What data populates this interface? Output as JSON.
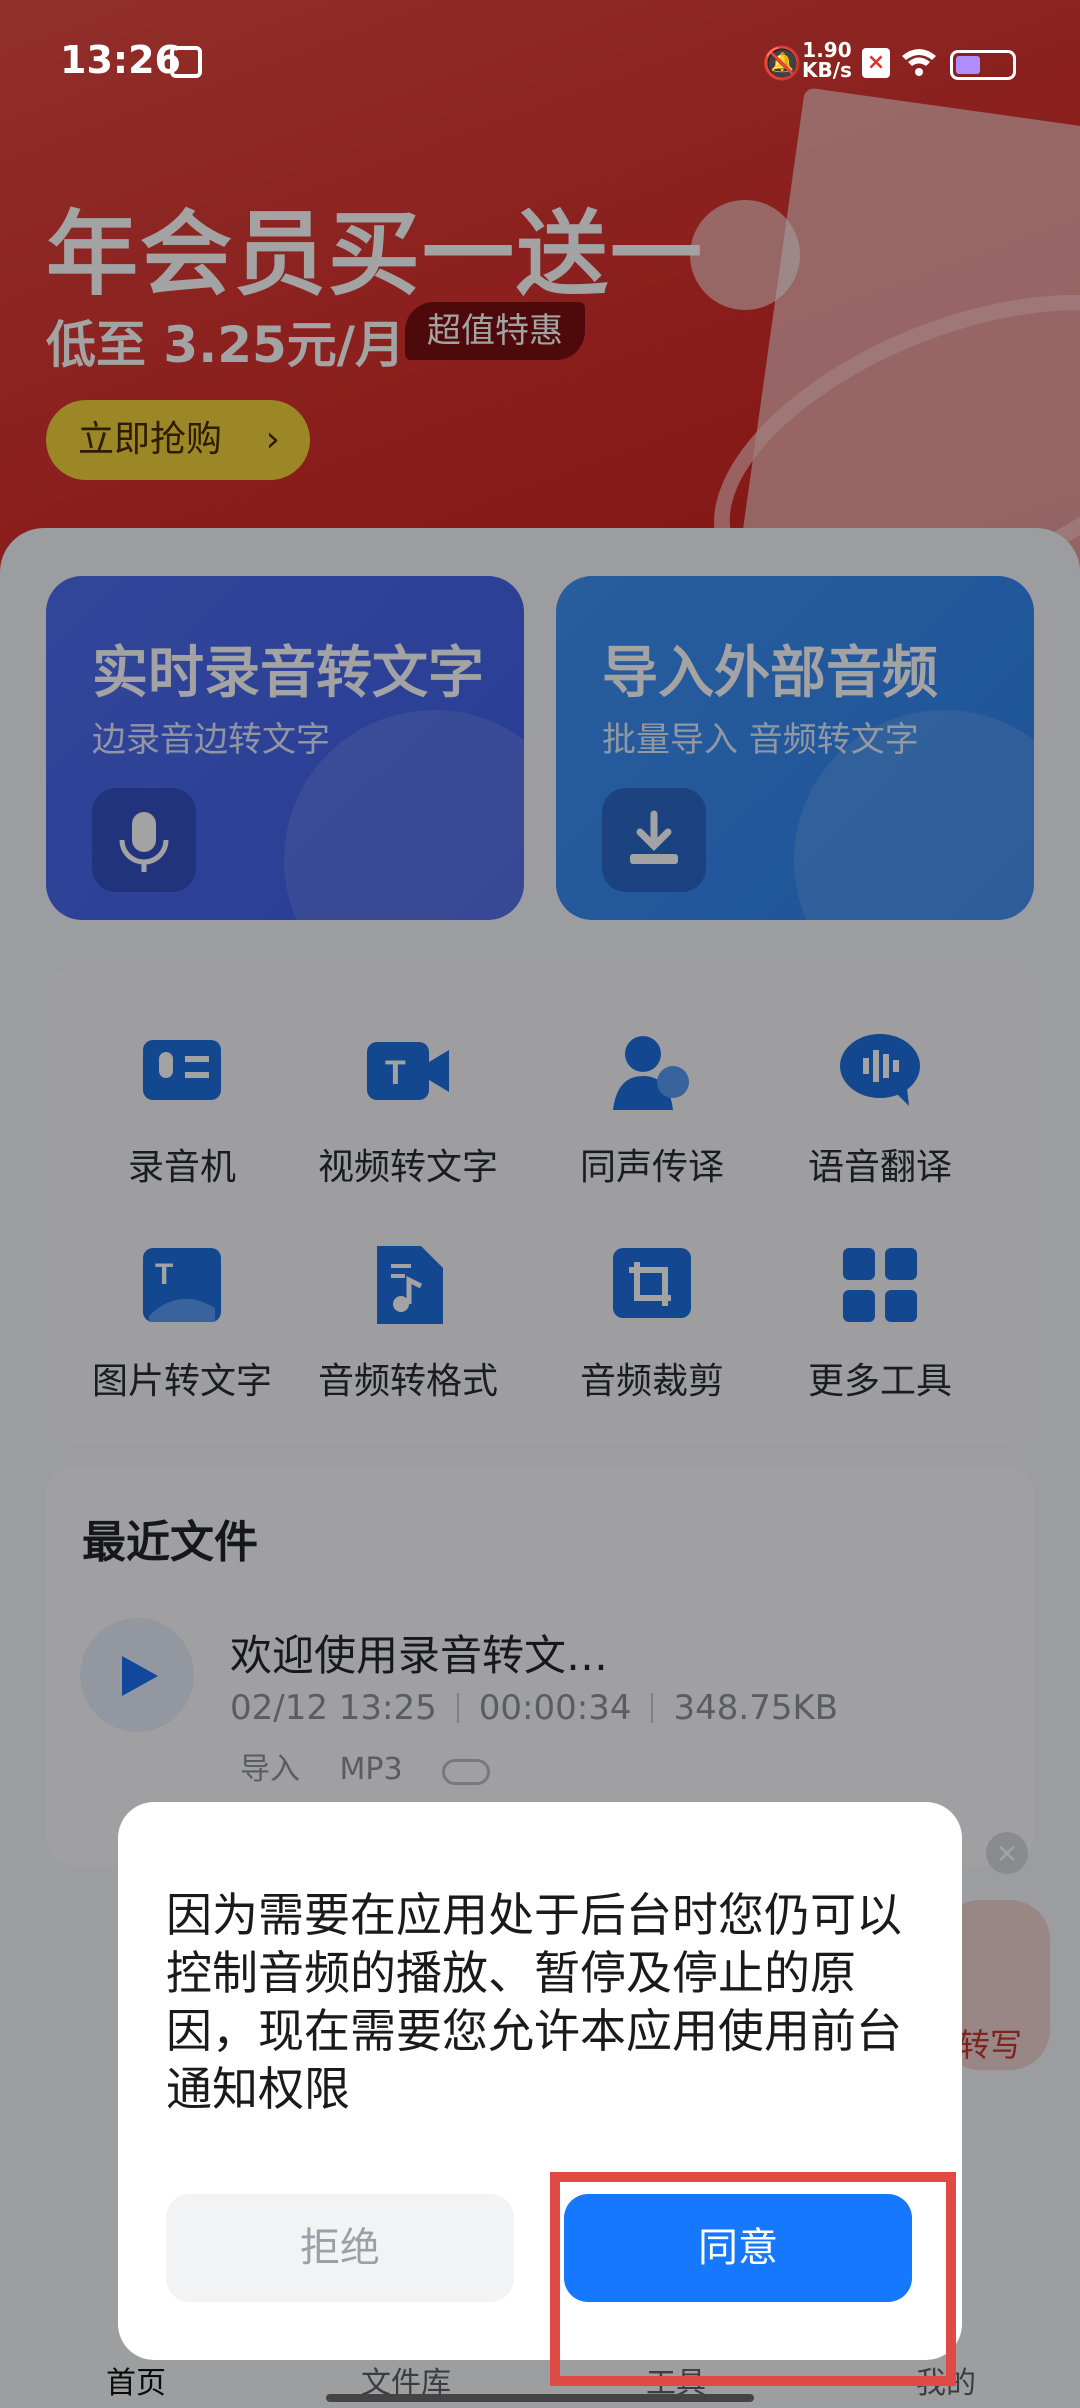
{
  "status_bar": {
    "time": "13:26",
    "net_speed_value": "1.90",
    "net_speed_unit": "KB/s",
    "icons": [
      "calendar-icon",
      "mute-bell-icon",
      "x-app-icon",
      "wifi-icon",
      "battery-icon"
    ]
  },
  "banner": {
    "title": "年会员买一送一",
    "subtitle": "低至 3.25元/月",
    "badge": "超值特惠",
    "button": "立即抢购",
    "chevron": "›"
  },
  "feature_cards": [
    {
      "title": "实时录音转文字",
      "subtitle": "边录音边转文字",
      "icon": "microphone-icon"
    },
    {
      "title": "导入外部音频",
      "subtitle": "批量导入 音频转文字",
      "icon": "import-download-icon"
    }
  ],
  "tools": [
    {
      "label": "录音机",
      "icon": "recorder-icon"
    },
    {
      "label": "视频转文字",
      "icon": "video-to-text-icon"
    },
    {
      "label": "同声传译",
      "icon": "simultaneous-interpretation-icon"
    },
    {
      "label": "语音翻译",
      "icon": "voice-translate-icon"
    },
    {
      "label": "图片转文字",
      "icon": "image-to-text-icon"
    },
    {
      "label": "音频转格式",
      "icon": "audio-convert-icon"
    },
    {
      "label": "音频裁剪",
      "icon": "audio-crop-icon"
    },
    {
      "label": "更多工具",
      "icon": "more-tools-icon"
    }
  ],
  "recent": {
    "title": "最近文件",
    "file": {
      "name": "欢迎使用录音转文…",
      "date": "02/12 13:25",
      "duration": "00:00:34",
      "size": "348.75KB",
      "tag_source": "导入",
      "tag_format": "MP3"
    }
  },
  "floating": {
    "close": "×",
    "text": "转写"
  },
  "tabbar": {
    "tabs": [
      "首页",
      "文件库",
      "工具",
      "我的"
    ],
    "active": 0
  },
  "dialog": {
    "message": "因为需要在应用处于后台时您仍可以控制音频的播放、暂停及停止的原因，现在需要您允许本应用使用前台通知权限",
    "reject": "拒绝",
    "agree": "同意"
  },
  "colors": {
    "banner_red": "#d62c29",
    "primary_blue": "#1677ff",
    "highlight_red": "#e04a45"
  }
}
